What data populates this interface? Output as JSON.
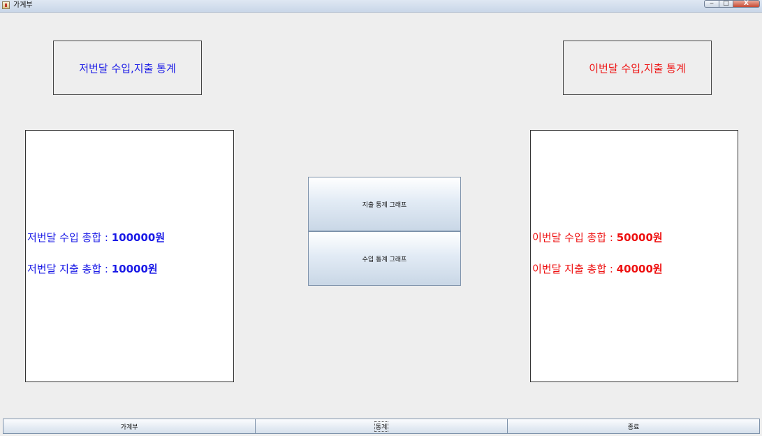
{
  "window": {
    "title": "가계부",
    "minimize_glyph": "‒",
    "maximize_glyph": "□",
    "close_glyph": "X"
  },
  "previous_month": {
    "header": "저번달 수입,지출 통계",
    "income_label": "저번달 수입 총합 : ",
    "income_value": "100000원",
    "expense_label": "저번달 지출 총합 : ",
    "expense_value": "10000원",
    "color": "#1a1ae6"
  },
  "current_month": {
    "header": "이번달 수입,지출 통계",
    "income_label": "이번달 수입 총합 : ",
    "income_value": "50000원",
    "expense_label": "이번달 지출 총합 : ",
    "expense_value": "40000원",
    "color": "#ee1111"
  },
  "buttons": {
    "expense_graph": "지출 통계 그래프",
    "income_graph": "수입 통계 그래프"
  },
  "tabs": [
    {
      "label": "가계부"
    },
    {
      "label": "통계",
      "active": true
    },
    {
      "label": "종료"
    }
  ],
  "icons": {
    "app": "ledger-app-icon"
  }
}
